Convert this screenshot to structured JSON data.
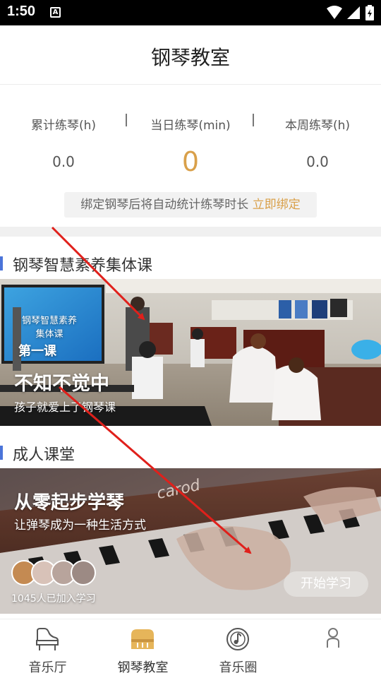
{
  "status_bar": {
    "time": "1:50",
    "notification_badge": "A"
  },
  "header": {
    "title": "钢琴教室"
  },
  "stats": {
    "items": [
      {
        "label": "累计练琴(h)",
        "value": "0.0"
      },
      {
        "label": "当日练琴(min)",
        "value": "0"
      },
      {
        "label": "本周练琴(h)",
        "value": "0.0"
      }
    ],
    "bind_hint": "绑定钢琴后将自动统计练琴时长",
    "bind_link": "立即绑定"
  },
  "section_group": {
    "title": "钢琴智慧素养集体课",
    "banner_screen_title": "钢琴智慧素养集体课",
    "banner_screen_lesson": "第一课",
    "banner_headline": "不知不觉中",
    "banner_subline": "孩子就爱上了钢琴课"
  },
  "section_adult": {
    "title": "成人课堂",
    "banner_headline": "从零起步学琴",
    "banner_subline": "让弹琴成为一种生活方式",
    "piano_brand": "carod",
    "joined_text": "1045人已加入学习",
    "start_button": "开始学习"
  },
  "tabbar": {
    "tabs": [
      {
        "label": "音乐厅",
        "icon": "grand-piano-icon"
      },
      {
        "label": "钢琴教室",
        "icon": "upright-piano-icon"
      },
      {
        "label": "音乐圈",
        "icon": "music-disc-icon"
      },
      {
        "label": "",
        "icon": "person-icon"
      }
    ]
  },
  "colors": {
    "accent_gold": "#d9a04a",
    "section_bar_blue": "#4b74d9",
    "annotation_arrow": "#e0201b"
  }
}
